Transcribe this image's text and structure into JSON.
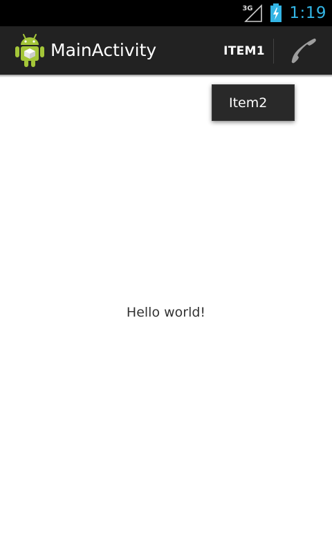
{
  "status_bar": {
    "network_type": "3G",
    "time": "1:19",
    "clock_color": "#33b5e5"
  },
  "action_bar": {
    "title": "MainActivity",
    "app_icon": "android-icon",
    "action_item_label": "ITEM1",
    "call_icon": "phone-icon",
    "background_color": "#222222"
  },
  "overflow_menu": {
    "items": [
      {
        "label": "Item2"
      }
    ]
  },
  "content": {
    "text": "Hello world!"
  }
}
